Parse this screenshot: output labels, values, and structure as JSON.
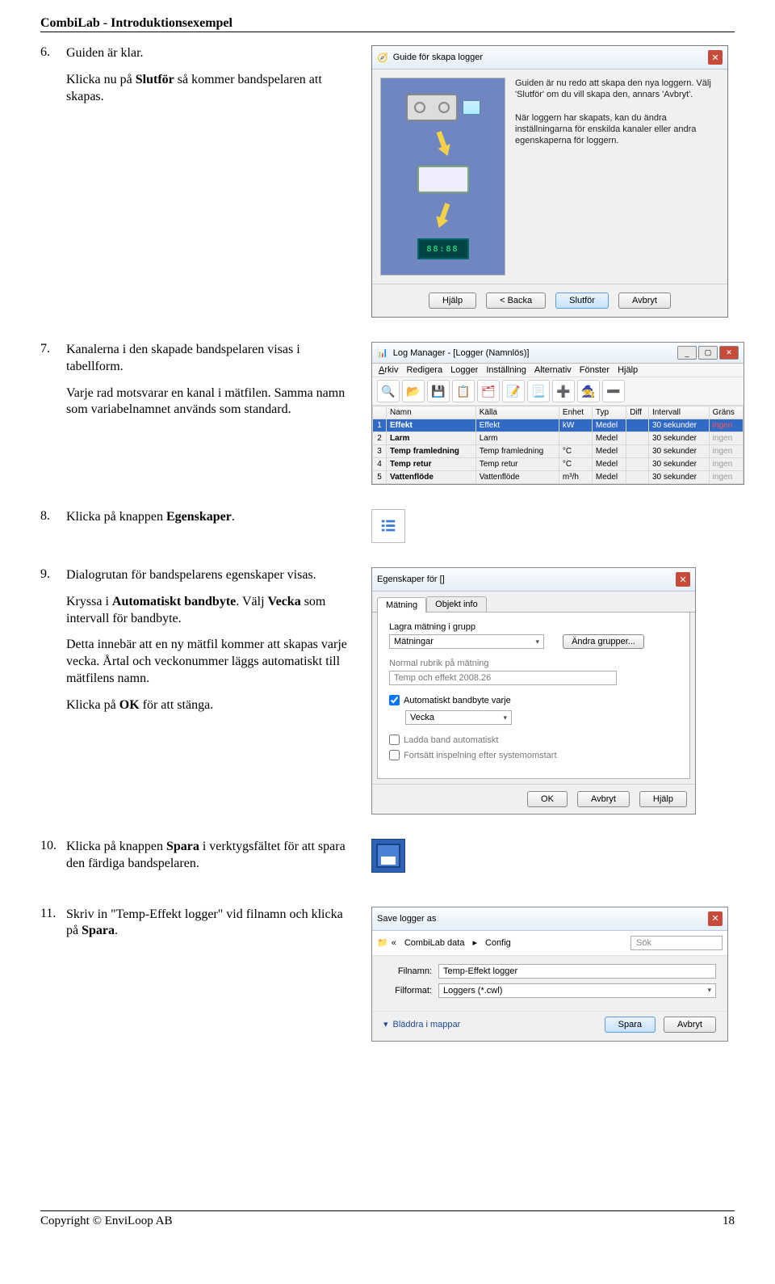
{
  "header": {
    "title": "CombiLab - Introduktionsexempel"
  },
  "footer": {
    "copyright": "Copyright © EnviLoop AB",
    "page": "18"
  },
  "steps": {
    "s6": {
      "num": "6.",
      "p1": "Guiden är klar.",
      "p2_a": "Klicka nu på ",
      "p2_b": "Slutför",
      "p2_c": " så kommer bandspelaren att skapas."
    },
    "s7": {
      "num": "7.",
      "p1": "Kanalerna i den skapade bandspelaren visas i tabellform.",
      "p2": "Varje rad motsvarar en kanal i mätfilen. Samma namn som variabelnamnet används som standard."
    },
    "s8": {
      "num": "8.",
      "p1_a": "Klicka på knappen ",
      "p1_b": "Egenskaper",
      "p1_c": "."
    },
    "s9": {
      "num": "9.",
      "p1": "Dialogrutan för bandspelarens egenskaper visas.",
      "p2_a": "Kryssa i ",
      "p2_b": "Automatiskt bandbyte",
      "p2_c": ". Välj ",
      "p2_d": "Vecka",
      "p2_e": " som intervall för bandbyte.",
      "p3": "Detta innebär att en ny mätfil kommer att skapas varje vecka. Årtal och veckonummer läggs automatiskt till mätfilens namn.",
      "p4_a": "Klicka på ",
      "p4_b": "OK",
      "p4_c": " för att stänga."
    },
    "s10": {
      "num": "10.",
      "p1_a": "Klicka på knappen ",
      "p1_b": "Spara",
      "p1_c": " i verktygsfältet för att spara den färdiga bandspelaren."
    },
    "s11": {
      "num": "11.",
      "p1_a": "Skriv in \"Temp-Effekt logger\" vid filnamn och klicka på ",
      "p1_b": "Spara",
      "p1_c": "."
    }
  },
  "wiz": {
    "title": "Guide för skapa logger",
    "text1": "Guiden är nu redo att skapa den nya loggern. Välj 'Slutför' om du vill skapa den, annars 'Avbryt'.",
    "text2": "När loggern har skapats, kan du ändra inställningarna för enskilda kanaler eller andra egenskaperna för loggern.",
    "counter": "88:88",
    "btn_help": "Hjälp",
    "btn_back": "< Backa",
    "btn_finish": "Slutför",
    "btn_cancel": "Avbryt"
  },
  "logmgr": {
    "title": "Log Manager - [Logger (Namnlös)]",
    "menu": {
      "arkiv": "Arkiv",
      "redigera": "Redigera",
      "logger": "Logger",
      "installning": "Inställning",
      "alternativ": "Alternativ",
      "fonster": "Fönster",
      "hjalp": "Hjälp"
    },
    "cols": {
      "n": "",
      "namn": "Namn",
      "kalla": "Källa",
      "enhet": "Enhet",
      "typ": "Typ",
      "diff": "Diff",
      "intervall": "Intervall",
      "grans": "Gräns"
    },
    "rows": [
      {
        "n": "1",
        "namn": "Effekt",
        "kalla": "Effekt",
        "enhet": "kW",
        "typ": "Medel",
        "diff": "",
        "intervall": "30 sekunder",
        "grans": "ingen"
      },
      {
        "n": "2",
        "namn": "Larm",
        "kalla": "Larm",
        "enhet": "",
        "typ": "Medel",
        "diff": "",
        "intervall": "30 sekunder",
        "grans": "ingen"
      },
      {
        "n": "3",
        "namn": "Temp framledning",
        "kalla": "Temp framledning",
        "enhet": "°C",
        "typ": "Medel",
        "diff": "",
        "intervall": "30 sekunder",
        "grans": "ingen"
      },
      {
        "n": "4",
        "namn": "Temp retur",
        "kalla": "Temp retur",
        "enhet": "°C",
        "typ": "Medel",
        "diff": "",
        "intervall": "30 sekunder",
        "grans": "ingen"
      },
      {
        "n": "5",
        "namn": "Vattenflöde",
        "kalla": "Vattenflöde",
        "enhet": "m³/h",
        "typ": "Medel",
        "diff": "",
        "intervall": "30 sekunder",
        "grans": "ingen"
      }
    ]
  },
  "props": {
    "title": "Egenskaper för []",
    "tab1": "Mätning",
    "tab2": "Objekt info",
    "lbl_store": "Lagra mätning i grupp",
    "val_store": "Mätningar",
    "btn_groups": "Ändra grupper...",
    "lbl_rubrik": "Normal rubrik på mätning",
    "val_rubrik": "Temp och effekt 2008.26",
    "chk_auto": "Automatiskt bandbyte varje",
    "val_interval": "Vecka",
    "chk_load": "Ladda band automatiskt",
    "chk_cont": "Fortsätt inspelning efter systemomstart",
    "btn_ok": "OK",
    "btn_cancel": "Avbryt",
    "btn_help": "Hjälp"
  },
  "save": {
    "title": "Save logger as",
    "crumb1": "CombiLab data",
    "crumb2": "Config",
    "search_ph": "Sök",
    "lbl_name": "Filnamn:",
    "val_name": "Temp-Effekt logger",
    "lbl_format": "Filformat:",
    "val_format": "Loggers (*.cwl)",
    "expand": "Bläddra i mappar",
    "btn_save": "Spara",
    "btn_cancel": "Avbryt"
  }
}
